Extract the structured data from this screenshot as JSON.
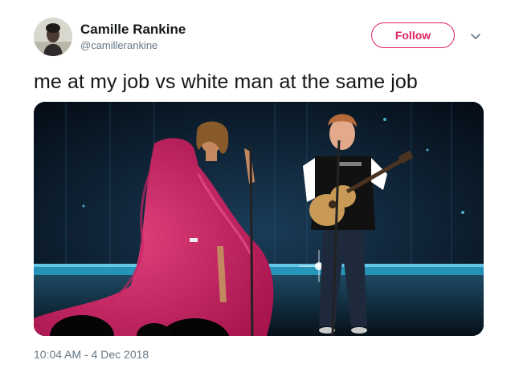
{
  "tweet": {
    "author": {
      "display_name": "Camille Rankine",
      "handle": "@camillerankine",
      "avatar_icon": "avatar-photo"
    },
    "follow_label": "Follow",
    "caret_icon": "chevron-down-icon",
    "text": "me at my job vs white man at the same job",
    "timestamp": "10:04 AM - 4 Dec 2018",
    "colors": {
      "accent": "#e0245e",
      "secondary_text": "#657786",
      "primary_text": "#14171a"
    }
  }
}
